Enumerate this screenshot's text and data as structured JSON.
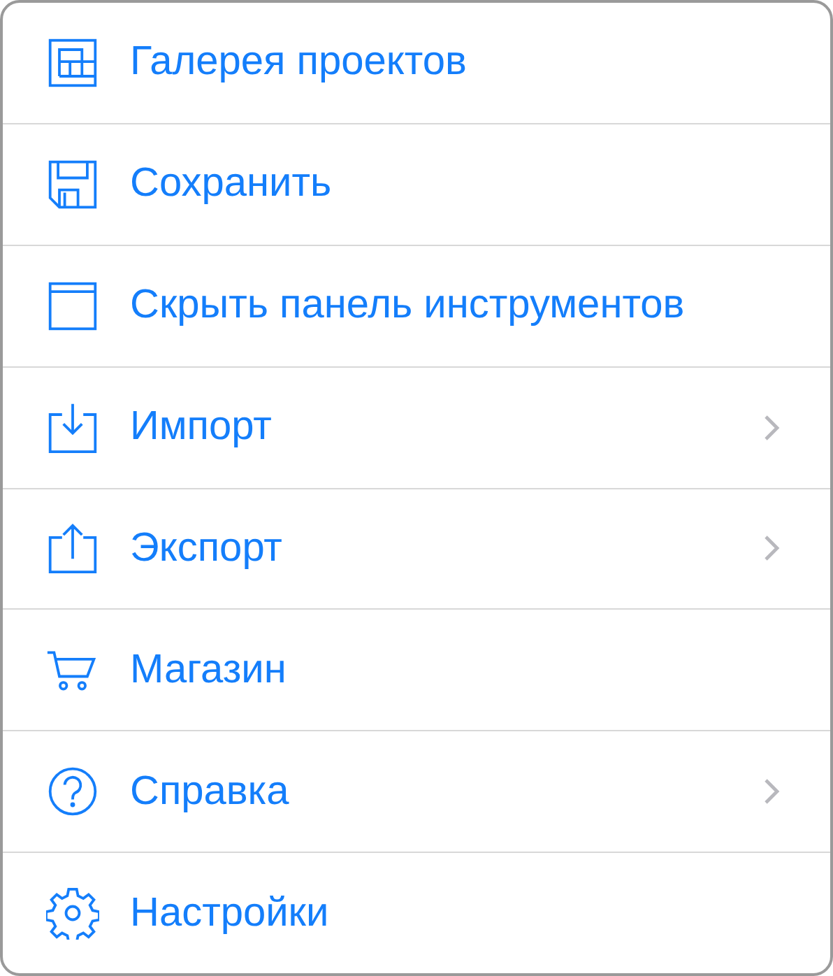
{
  "menu": {
    "items": [
      {
        "label": "Галерея проектов",
        "submenu": false
      },
      {
        "label": "Сохранить",
        "submenu": false
      },
      {
        "label": "Скрыть панель инструментов",
        "submenu": false
      },
      {
        "label": "Импорт",
        "submenu": true
      },
      {
        "label": "Экспорт",
        "submenu": true
      },
      {
        "label": "Магазин",
        "submenu": false
      },
      {
        "label": "Справка",
        "submenu": true
      },
      {
        "label": "Настройки",
        "submenu": false
      }
    ]
  }
}
